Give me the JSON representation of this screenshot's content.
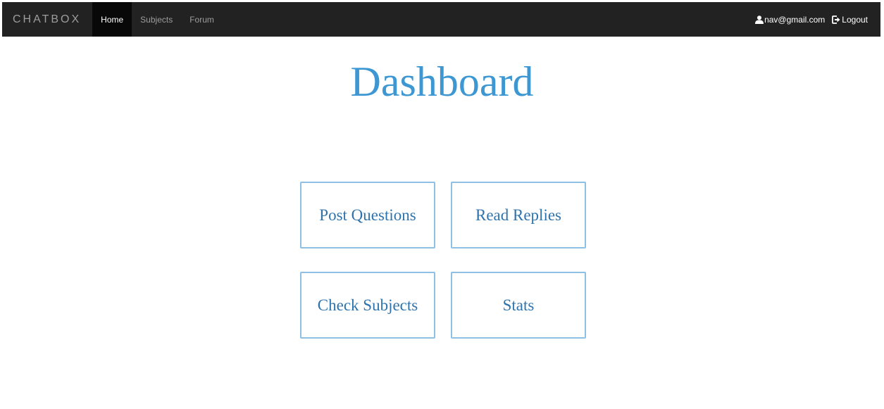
{
  "navbar": {
    "brand": "CHATBOX",
    "links": [
      {
        "label": "Home",
        "active": true
      },
      {
        "label": "Subjects",
        "active": false
      },
      {
        "label": "Forum",
        "active": false
      }
    ],
    "user": {
      "email": "nav@gmail.com",
      "icon": "user-icon"
    },
    "logout": {
      "label": "Logout",
      "icon": "logout-icon"
    }
  },
  "main": {
    "title": "Dashboard",
    "tiles": [
      {
        "label": "Post Questions"
      },
      {
        "label": "Read Replies"
      },
      {
        "label": "Check Subjects"
      },
      {
        "label": "Stats"
      }
    ]
  },
  "colors": {
    "navbar_bg": "#222222",
    "active_tab_bg": "#080808",
    "title": "#3d97d3",
    "tile_border": "#8ec0e4",
    "tile_text": "#2f73ad"
  }
}
